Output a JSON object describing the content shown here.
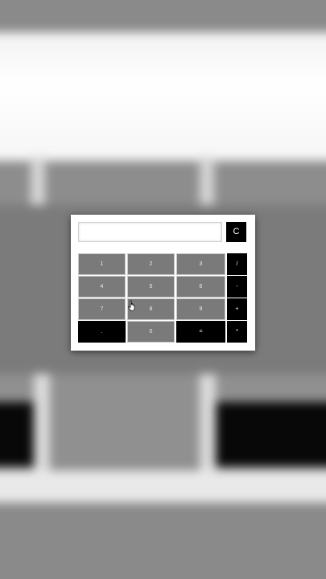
{
  "calculator": {
    "display_value": "",
    "clear_label": "C",
    "keys": [
      {
        "label": "1",
        "name": "key-1",
        "style": "num"
      },
      {
        "label": "2",
        "name": "key-2",
        "style": "num"
      },
      {
        "label": "3",
        "name": "key-3",
        "style": "num"
      },
      {
        "label": "/",
        "name": "key-divide",
        "style": "op"
      },
      {
        "label": "4",
        "name": "key-4",
        "style": "num"
      },
      {
        "label": "5",
        "name": "key-5",
        "style": "num"
      },
      {
        "label": "6",
        "name": "key-6",
        "style": "num"
      },
      {
        "label": "-",
        "name": "key-minus",
        "style": "op"
      },
      {
        "label": "7",
        "name": "key-7",
        "style": "num"
      },
      {
        "label": "8",
        "name": "key-8",
        "style": "num"
      },
      {
        "label": "9",
        "name": "key-9",
        "style": "num"
      },
      {
        "label": "+",
        "name": "key-plus",
        "style": "op"
      },
      {
        "label": ".",
        "name": "key-decimal",
        "style": "dark"
      },
      {
        "label": "0",
        "name": "key-0",
        "style": "num"
      },
      {
        "label": "=",
        "name": "key-equals",
        "style": "dark"
      },
      {
        "label": "*",
        "name": "key-multiply",
        "style": "op"
      }
    ]
  },
  "cursor": {
    "icon": "hand-pointer-icon"
  }
}
